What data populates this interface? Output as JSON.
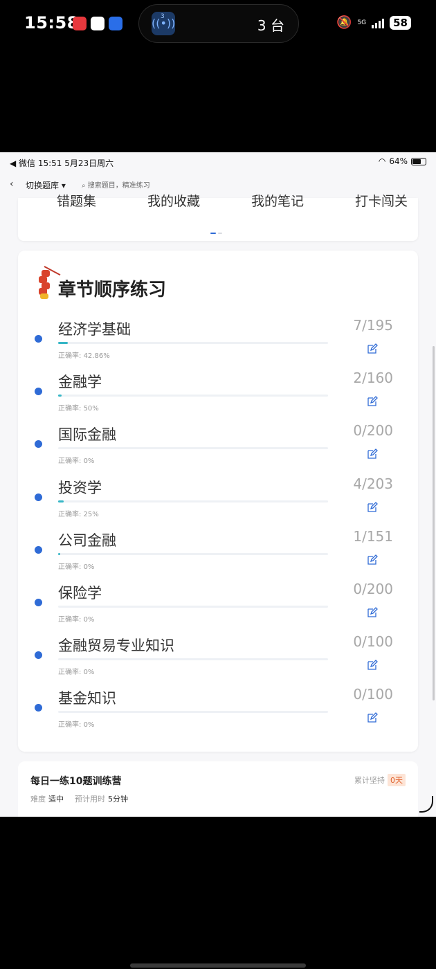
{
  "phone_status": {
    "time": "15:58",
    "island_badge": "3",
    "island_text": "3 台",
    "network": "5G",
    "battery": "58"
  },
  "ipad_status": {
    "left": "◀ 微信   15:51   5月23日周六",
    "battery": "64%"
  },
  "topbar": {
    "switch_label": "切换题库 ▾",
    "search_placeholder": "搜索题目，精准练习"
  },
  "quick_links": [
    "错题集",
    "我的收藏",
    "我的笔记",
    "打卡闯关"
  ],
  "chapter_section": {
    "title": "章节顺序练习",
    "accuracy_prefix": "正确率: ",
    "chapters": [
      {
        "name": "经济学基础",
        "accuracy": "42.86%",
        "count": "7/195",
        "progress": 0.036
      },
      {
        "name": "金融学",
        "accuracy": "50%",
        "count": "2/160",
        "progress": 0.0125
      },
      {
        "name": "国际金融",
        "accuracy": "0%",
        "count": "0/200",
        "progress": 0
      },
      {
        "name": "投资学",
        "accuracy": "25%",
        "count": "4/203",
        "progress": 0.0197
      },
      {
        "name": "公司金融",
        "accuracy": "0%",
        "count": "1/151",
        "progress": 0.0066
      },
      {
        "name": "保险学",
        "accuracy": "0%",
        "count": "0/200",
        "progress": 0
      },
      {
        "name": "金融贸易专业知识",
        "accuracy": "0%",
        "count": "0/100",
        "progress": 0
      },
      {
        "name": "基金知识",
        "accuracy": "0%",
        "count": "0/100",
        "progress": 0
      }
    ]
  },
  "camp": {
    "title": "每日一练10题训练营",
    "persist_label": "累计坚持",
    "days": "0天",
    "difficulty_label": "难度",
    "difficulty": "适中",
    "time_label": "预计用时",
    "time": "5分钟"
  },
  "colors": {
    "accent": "#2f6bd6",
    "progress": "#36b6c6",
    "streak": "#e0622d"
  }
}
